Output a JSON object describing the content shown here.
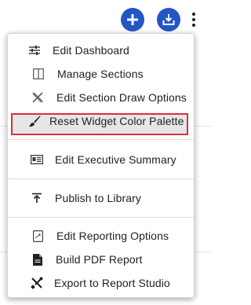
{
  "toolbar": {
    "add_icon": "plus-icon",
    "download_icon": "download-tray-icon",
    "more_icon": "vertical-ellipsis-icon",
    "accent_color": "#2456c5"
  },
  "menu": {
    "items": [
      {
        "label": "Edit Dashboard",
        "icon": "sliders-icon"
      },
      {
        "label": "Manage Sections",
        "icon": "columns-icon"
      },
      {
        "label": "Edit Section Draw Options",
        "icon": "draw-options-icon"
      },
      {
        "label": "Reset Widget Color Palette",
        "icon": "paintbrush-icon"
      },
      {
        "label": "Edit Executive Summary",
        "icon": "summary-card-icon",
        "highlighted": true
      },
      {
        "label": "Publish to Library",
        "icon": "publish-upload-icon"
      },
      {
        "label": "Edit Reporting Options",
        "icon": "report-options-icon"
      },
      {
        "label": "Build PDF Report",
        "icon": "pdf-file-icon"
      },
      {
        "label": "Export to Report Studio",
        "icon": "tools-icon"
      }
    ],
    "highlight_color": "#d9303a"
  }
}
